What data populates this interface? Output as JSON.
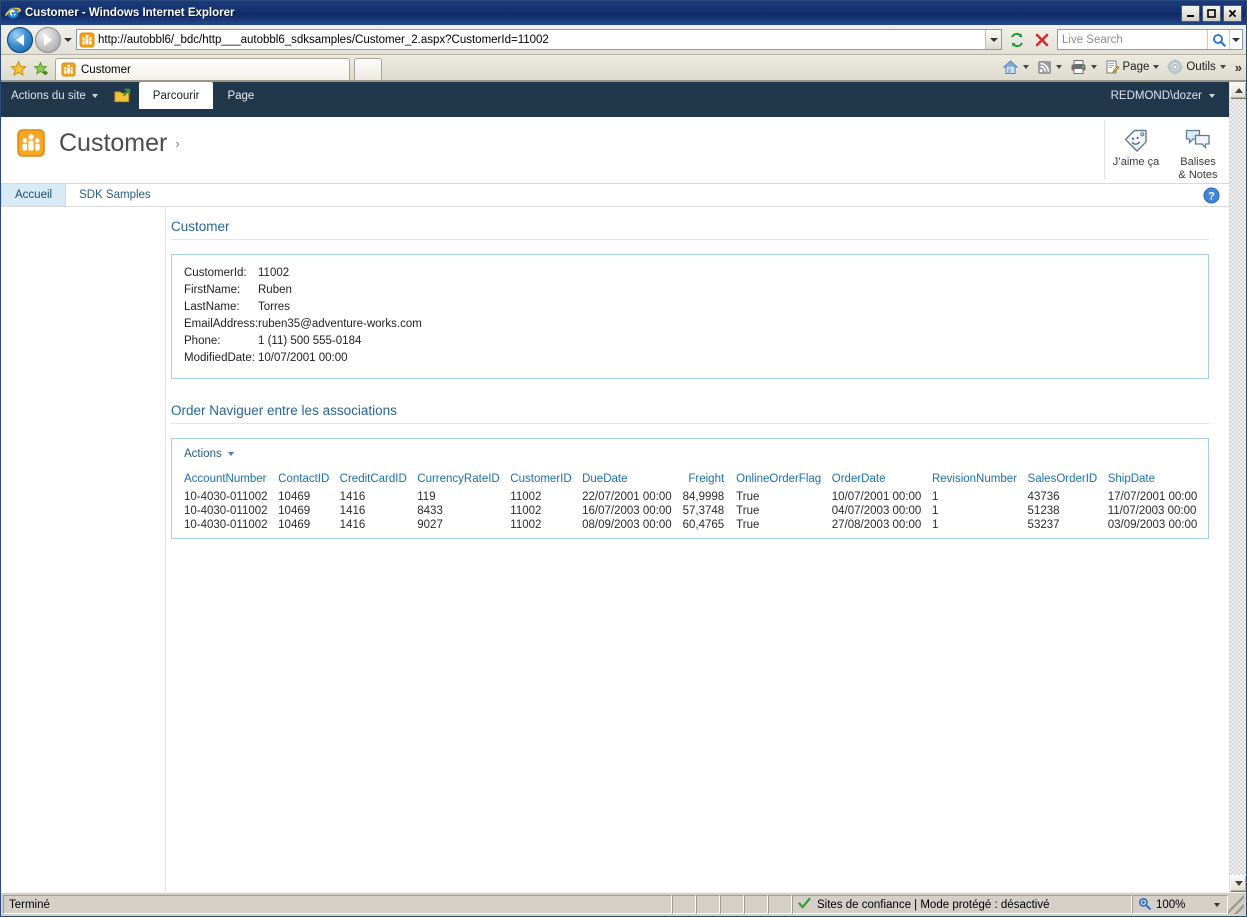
{
  "window": {
    "title": "Customer - Windows Internet Explorer",
    "minimize_label": "Minimize",
    "maximize_label": "Maximize",
    "close_label": "Close"
  },
  "browser": {
    "back_label": "Back",
    "forward_label": "Forward",
    "recent_pages_label": "Recent Pages",
    "address": "http://autobbl6/_bdc/http___autobbl6_sdksamples/Customer_2.aspx?CustomerId=11002",
    "refresh_label": "Refresh",
    "stop_label": "Stop",
    "search_placeholder": "Live Search",
    "search_value": "",
    "favorites_label": "Favorites Center",
    "add_favorite_label": "Add to Favorites",
    "tabs": [
      {
        "label": "Customer",
        "icon": "customer-favicon",
        "active": true
      }
    ],
    "new_tab_label": "",
    "commands": [
      {
        "name": "home",
        "label": "",
        "icon": "home-icon",
        "caret": true
      },
      {
        "name": "feeds",
        "label": "",
        "icon": "rss-icon",
        "caret": true
      },
      {
        "name": "print",
        "label": "",
        "icon": "printer-icon",
        "caret": true
      },
      {
        "name": "page",
        "label": "Page",
        "icon": "page-icon",
        "caret": true
      },
      {
        "name": "tools",
        "label": "Outils",
        "icon": "gear-icon",
        "caret": true
      }
    ],
    "overflow_label": "»"
  },
  "sharepoint": {
    "site_actions": "Actions du site",
    "navigate_up_label": "Navigate Up",
    "ribbon_tabs": [
      {
        "label": "Parcourir",
        "active": true
      },
      {
        "label": "Page",
        "active": false
      }
    ],
    "user": "REDMOND\\dozer",
    "logo_icon": "customer-entity-icon",
    "page_title": "Customer",
    "title_separator": "›",
    "social": [
      {
        "label": "J’aime ça",
        "icon": "tag-smiley-icon"
      },
      {
        "label": "Balises\n& Notes",
        "label_line1": "Balises",
        "label_line2": "& Notes",
        "icon": "notes-icon"
      }
    ],
    "nav_tabs": [
      {
        "label": "Accueil",
        "active": true
      },
      {
        "label": "SDK Samples",
        "active": false
      }
    ],
    "help_label": "Help",
    "help_icon": "help-icon"
  },
  "details_webpart": {
    "title": "Customer",
    "fields": [
      {
        "label": "CustomerId:",
        "value": "11002"
      },
      {
        "label": "FirstName:",
        "value": "Ruben"
      },
      {
        "label": "LastName:",
        "value": "Torres"
      },
      {
        "label": "EmailAddress:",
        "value": "ruben35@adventure-works.com"
      },
      {
        "label": "Phone:",
        "value": "1 (11) 500 555-0184"
      },
      {
        "label": "ModifiedDate:",
        "value": "10/07/2001 00:00"
      }
    ]
  },
  "orders_webpart": {
    "title": "Order Naviguer entre les associations",
    "actions_label": "Actions",
    "columns": [
      "AccountNumber",
      "ContactID",
      "CreditCardID",
      "CurrencyRateID",
      "CustomerID",
      "DueDate",
      "Freight",
      "OnlineOrderFlag",
      "OrderDate",
      "RevisionNumber",
      "SalesOrderID",
      "ShipDate"
    ],
    "rows": [
      {
        "AccountNumber": "10-4030-011002",
        "ContactID": "10469",
        "CreditCardID": "1416",
        "CurrencyRateID": "119",
        "CustomerID": "11002",
        "DueDate": "22/07/2001 00:00",
        "Freight": "84,9998",
        "OnlineOrderFlag": "True",
        "OrderDate": "10/07/2001 00:00",
        "RevisionNumber": "1",
        "SalesOrderID": "43736",
        "ShipDate": "17/07/2001 00:00"
      },
      {
        "AccountNumber": "10-4030-011002",
        "ContactID": "10469",
        "CreditCardID": "1416",
        "CurrencyRateID": "8433",
        "CustomerID": "11002",
        "DueDate": "16/07/2003 00:00",
        "Freight": "57,3748",
        "OnlineOrderFlag": "True",
        "OrderDate": "04/07/2003 00:00",
        "RevisionNumber": "1",
        "SalesOrderID": "51238",
        "ShipDate": "11/07/2003 00:00"
      },
      {
        "AccountNumber": "10-4030-011002",
        "ContactID": "10469",
        "CreditCardID": "1416",
        "CurrencyRateID": "9027",
        "CustomerID": "11002",
        "DueDate": "08/09/2003 00:00",
        "Freight": "60,4765",
        "OnlineOrderFlag": "True",
        "OrderDate": "27/08/2003 00:00",
        "RevisionNumber": "1",
        "SalesOrderID": "53237",
        "ShipDate": "03/09/2003 00:00"
      }
    ]
  },
  "statusbar": {
    "status": "Terminé",
    "zone": "Sites de confiance | Mode protégé : désactivé",
    "zone_icon": "checkmark-icon",
    "zoom": "100%",
    "zoom_icon": "zoom-icon"
  },
  "colors": {
    "titlebar": "#14306d",
    "ribbon": "#21374c",
    "link": "#2a6496",
    "header_link": "#1a6fad",
    "accent_orange": "#f2a21c",
    "active_tab_bg": "#d8eaf7",
    "box_border": "#a7cfe8"
  }
}
